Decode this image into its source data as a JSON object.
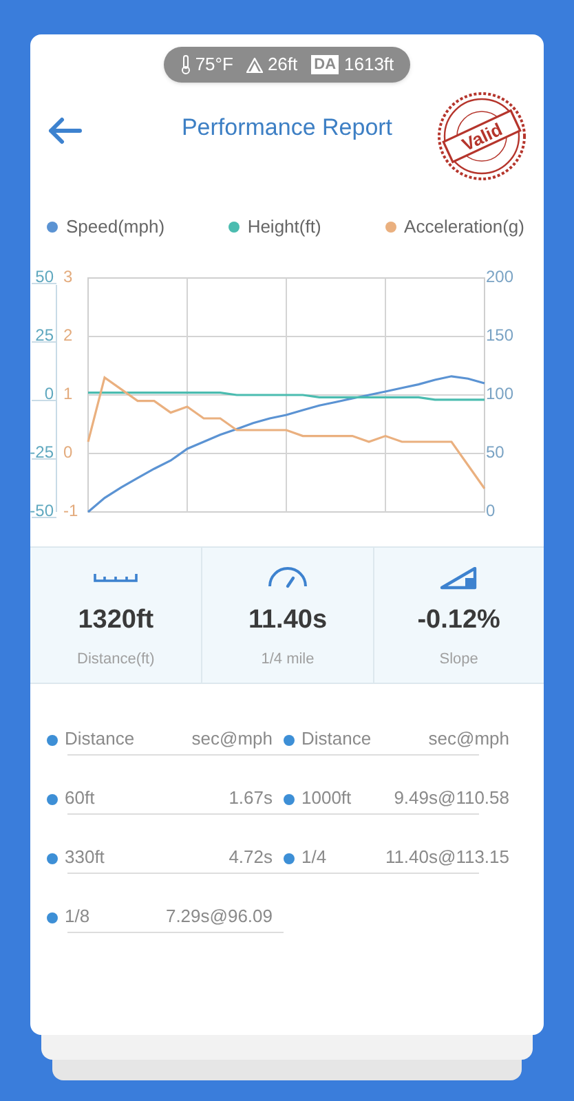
{
  "conditions": {
    "temperature": "75°F",
    "elevation": "26ft",
    "badge": "DA",
    "density_altitude": "1613ft"
  },
  "header": {
    "title": "Performance Report",
    "stamp": "Valid"
  },
  "chart": {
    "chart_data": {
      "type": "line",
      "ylim": [
        0,
        200
      ],
      "yticks": [
        200,
        150,
        100,
        50,
        0
      ],
      "y2lim": [
        -50,
        50
      ],
      "y2ticks": [
        50,
        25,
        0,
        -25,
        -50
      ],
      "y3lim": [
        -1,
        3
      ],
      "y3ticks": [
        3,
        2,
        1,
        0,
        -1
      ],
      "grid": true,
      "series": [
        {
          "name": "Speed(mph)",
          "color": "#5b93d3",
          "values": [
            0,
            12,
            21,
            29,
            37,
            44,
            54,
            60,
            66,
            71,
            76,
            80,
            83,
            87,
            91,
            94,
            97,
            100,
            103,
            106,
            109,
            113,
            116,
            114,
            110
          ]
        },
        {
          "name": "Height(ft)",
          "color": "#4bbcb0",
          "axis": "y2",
          "values": [
            1,
            1,
            1,
            1,
            1,
            1,
            1,
            1,
            1,
            0,
            0,
            0,
            0,
            0,
            -1,
            -1,
            -1,
            -1,
            -1,
            -1,
            -1,
            -2,
            -2,
            -2,
            -2
          ]
        },
        {
          "name": "Acceleration(g)",
          "color": "#eab07f",
          "axis": "y3",
          "values": [
            0.2,
            1.3,
            1.1,
            0.9,
            0.9,
            0.7,
            0.8,
            0.6,
            0.6,
            0.4,
            0.4,
            0.4,
            0.4,
            0.3,
            0.3,
            0.3,
            0.3,
            0.2,
            0.3,
            0.2,
            0.2,
            0.2,
            0.2,
            -0.2,
            -0.6
          ]
        }
      ]
    }
  },
  "stats": [
    {
      "kind": "distance",
      "value": "1320ft",
      "label": "Distance(ft)"
    },
    {
      "kind": "time",
      "value": "11.40s",
      "label": "1/4 mile"
    },
    {
      "kind": "slope",
      "value": "-0.12%",
      "label": "Slope"
    }
  ],
  "splits": [
    {
      "header": [
        "Distance",
        "sec@mph"
      ],
      "rows": [
        [
          "60ft",
          "1.67s"
        ],
        [
          "330ft",
          "4.72s"
        ],
        [
          "1/8",
          "7.29s@96.09"
        ]
      ]
    },
    {
      "header": [
        "Distance",
        "sec@mph"
      ],
      "rows": [
        [
          "1000ft",
          "9.49s@110.58"
        ],
        [
          "1/4",
          "11.40s@113.15"
        ]
      ]
    }
  ]
}
